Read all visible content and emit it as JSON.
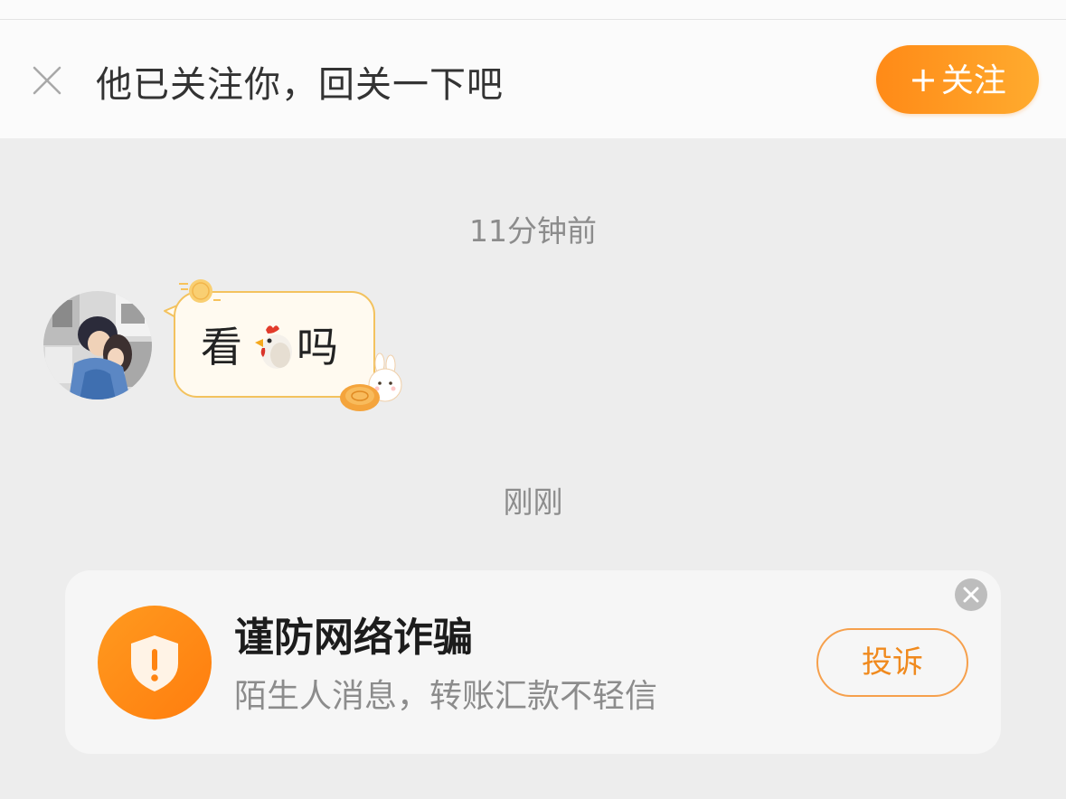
{
  "follow_banner": {
    "close_icon": "close-icon",
    "text": "他已关注你，回关一下吧",
    "follow_button_plus": "+",
    "follow_button_label": "关注",
    "accent_color": "#ff8a17"
  },
  "messages": [
    {
      "timestamp": "11分钟前",
      "sender": "other",
      "text_before": "看",
      "emoji": "chicken-emoji",
      "text_after": "吗"
    }
  ],
  "second_timestamp": "刚刚",
  "fraud_warning": {
    "icon": "shield-exclamation-icon",
    "title": "谨防网络诈骗",
    "subtitle": "陌生人消息，转账汇款不轻信",
    "report_button_label": "投诉",
    "close_icon": "close-icon"
  }
}
